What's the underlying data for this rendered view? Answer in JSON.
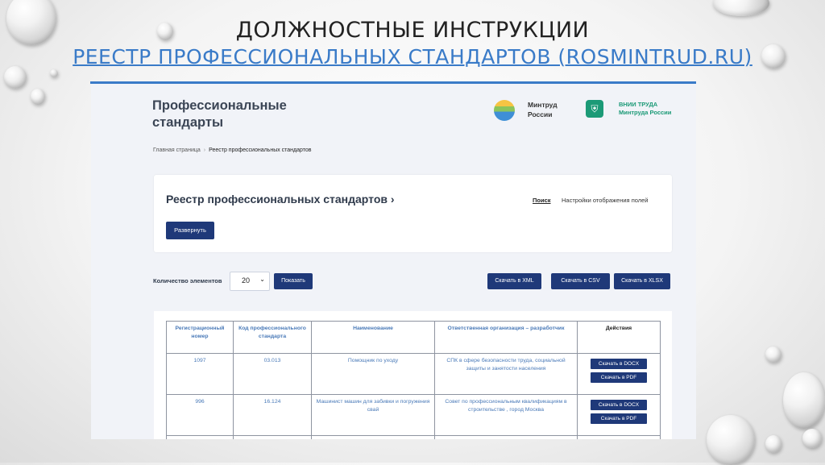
{
  "slide": {
    "title": "ДОЛЖНОСТНЫЕ ИНСТРУКЦИИ",
    "subtitle": "РЕЕСТР ПРОФЕССИОНАЛЬНЫХ СТАНДАРТОВ (ROSMINTRUD.RU)"
  },
  "site": {
    "title_line1": "Профессиональные",
    "title_line2": "стандарты",
    "logo1_line1": "Минтруд",
    "logo1_line2": "России",
    "logo2_line1": "ВНИИ ТРУДА",
    "logo2_line2": "Минтруда России",
    "breadcrumb": {
      "home": "Главная страница",
      "current": "Реестр профессиональных стандартов"
    }
  },
  "registry": {
    "title": "Реестр профессиональных стандартов ›",
    "tab_search": "Поиск",
    "tab_settings": "Настройки отображения полей",
    "expand_button": "Развернуть"
  },
  "controls": {
    "count_label": "Количество элементов",
    "count_value": "20",
    "show_button": "Показать",
    "download_xml": "Скачать в XML",
    "download_csv": "Скачать в CSV",
    "download_xlsx": "Скачать в XLSX"
  },
  "table": {
    "headers": {
      "reg_number": "Регистрационный номер",
      "code": "Код профессионального стандарта",
      "name": "Наименование",
      "org": "Ответственная организация – разработчик",
      "actions": "Действия"
    },
    "rows": [
      {
        "reg": "1097",
        "code": "03.013",
        "name": "Помощник по уходу",
        "org": "СПК в сфере безопасности труда, социальной защиты и занятости населения",
        "docx": "Скачать в DOCX",
        "pdf": "Скачать в PDF"
      },
      {
        "reg": "996",
        "code": "16.124",
        "name": "Машинист машин для забивки и погружения свай",
        "org": "Совет по профессиональным квалификациям в строительстве , город Москва",
        "docx": "Скачать в DOCX",
        "pdf": "Скачать в PDF"
      }
    ]
  },
  "colors": {
    "accent": "#3a7bc8",
    "button": "#1f3979",
    "link": "#4a7ab8"
  }
}
